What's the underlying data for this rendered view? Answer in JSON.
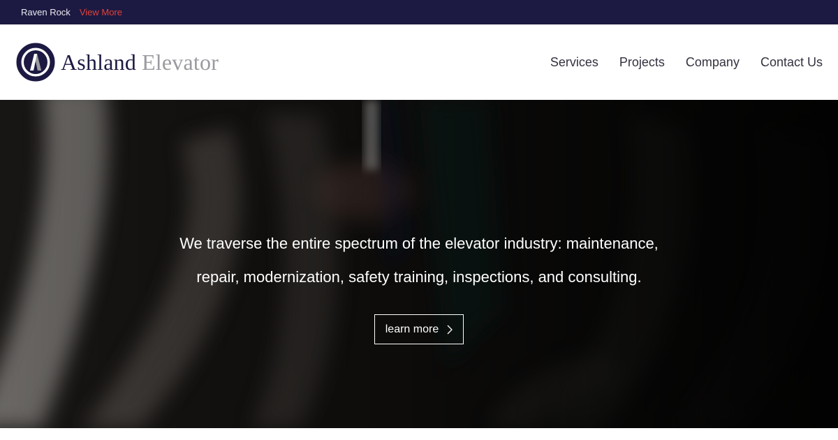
{
  "topbar": {
    "location": "Raven Rock",
    "view_more": "View More",
    "bg_color": "#1c1a42",
    "link_color": "#e0413a"
  },
  "header": {
    "logo_word1": "Ashland",
    "logo_word2": "Elevator",
    "logo_icon": "ashland-a-monogram-icon",
    "nav": [
      {
        "label": "Services"
      },
      {
        "label": "Projects"
      },
      {
        "label": "Company"
      },
      {
        "label": "Contact Us"
      }
    ]
  },
  "hero": {
    "line1": "We traverse the entire spectrum of the elevator industry: maintenance,",
    "line2": "repair, modernization, safety training, inspections, and consulting.",
    "cta_label": "learn more",
    "cta_icon": "chevron-right-icon"
  }
}
